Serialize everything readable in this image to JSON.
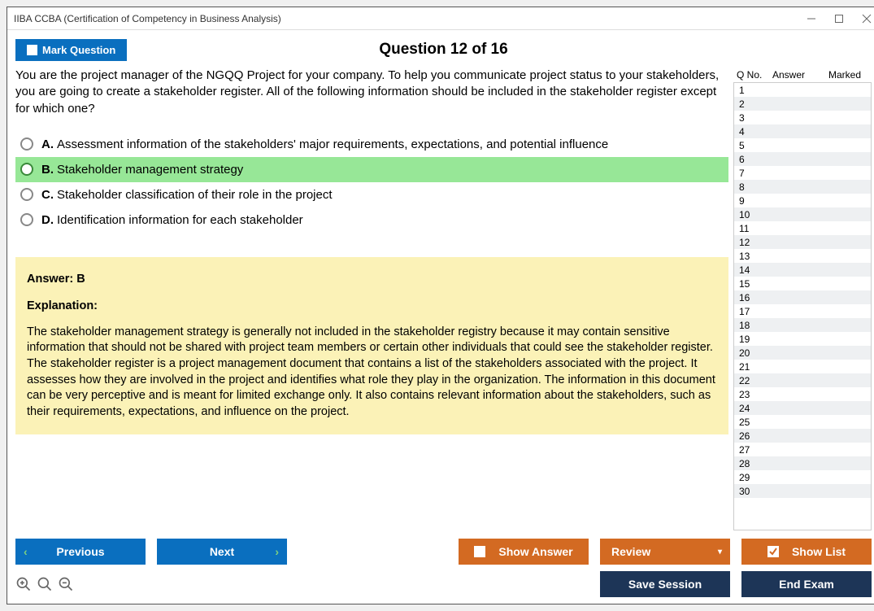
{
  "window_title": "IIBA CCBA (Certification of Competency in Business Analysis)",
  "mark_button": "Mark Question",
  "question_header": "Question 12 of 16",
  "question_text": "You are the project manager of the NGQQ Project for your company. To help you communicate project status to your stakeholders, you are going to create a stakeholder register. All of the following information should be included in the stakeholder register except for which one?",
  "options": [
    {
      "letter": "A.",
      "text": "Assessment information of the stakeholders' major requirements, expectations, and potential influence",
      "selected": false
    },
    {
      "letter": "B.",
      "text": "Stakeholder management strategy",
      "selected": true
    },
    {
      "letter": "C.",
      "text": "Stakeholder classification of their role in the project",
      "selected": false
    },
    {
      "letter": "D.",
      "text": "Identification information for each stakeholder",
      "selected": false
    }
  ],
  "answer_line": "Answer: B",
  "explanation_label": "Explanation:",
  "explanation_text": "The stakeholder management strategy is generally not included in the stakeholder registry because it may contain sensitive information that should not be shared with project team members or certain other individuals that could see the stakeholder register. The stakeholder register is a project management document that contains a list of the stakeholders associated with the project. It assesses how they are involved in the project and identifies what role they play in the organization. The information in this document can be very perceptive and is meant for limited exchange only. It also contains relevant information about the stakeholders, such as their requirements, expectations, and influence on the project.",
  "side_headers": {
    "q": "Q No.",
    "a": "Answer",
    "m": "Marked"
  },
  "side_rows": [
    1,
    2,
    3,
    4,
    5,
    6,
    7,
    8,
    9,
    10,
    11,
    12,
    13,
    14,
    15,
    16,
    17,
    18,
    19,
    20,
    21,
    22,
    23,
    24,
    25,
    26,
    27,
    28,
    29,
    30
  ],
  "buttons": {
    "previous": "Previous",
    "next": "Next",
    "show_answer": "Show Answer",
    "review": "Review",
    "show_list": "Show List",
    "save_session": "Save Session",
    "end_exam": "End Exam"
  }
}
